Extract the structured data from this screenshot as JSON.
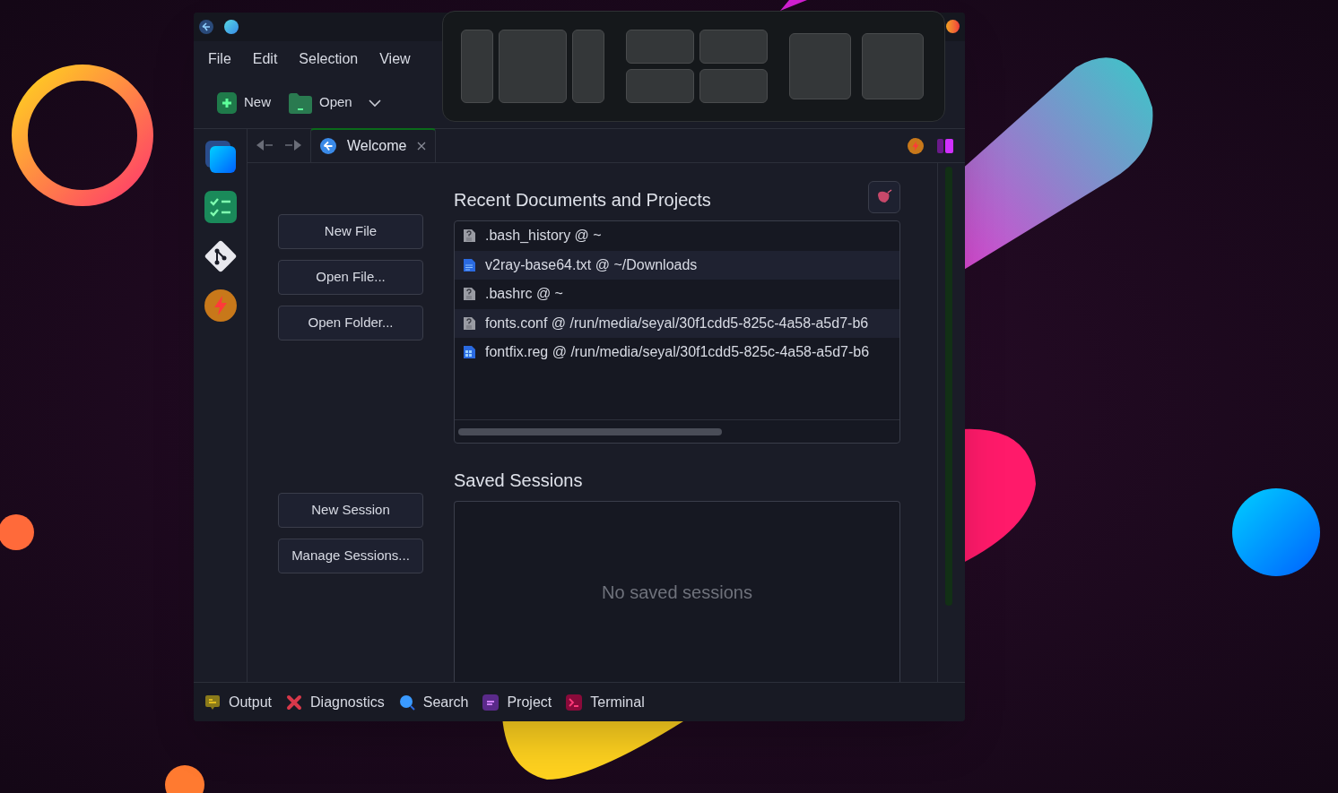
{
  "menu": [
    {
      "label": "File"
    },
    {
      "label": "Edit"
    },
    {
      "label": "Selection"
    },
    {
      "label": "View"
    }
  ],
  "toolbar": [
    {
      "label": "New",
      "kind": "new"
    },
    {
      "label": "Open",
      "kind": "open"
    }
  ],
  "tabs": [
    {
      "label": "Welcome",
      "selected": true
    }
  ],
  "start_buttons": [
    "New File",
    "Open File...",
    "Open Folder..."
  ],
  "recent": {
    "title": "Recent Documents and Projects",
    "items": [
      {
        "label": ".bash_history @ ~",
        "kind": "unknown"
      },
      {
        "label": "v2ray-base64.txt @ ~/Downloads",
        "kind": "text"
      },
      {
        "label": ".bashrc @ ~",
        "kind": "unknown"
      },
      {
        "label": "fonts.conf @ /run/media/seyal/30f1cdd5-825c-4a58-a5d7-b6",
        "kind": "unknown"
      },
      {
        "label": "fontfix.reg @ /run/media/seyal/30f1cdd5-825c-4a58-a5d7-b6",
        "kind": "registry"
      }
    ]
  },
  "sessions": {
    "title": "Saved Sessions",
    "buttons": [
      "New Session",
      "Manage Sessions..."
    ],
    "empty_text": "No saved sessions"
  },
  "bottom_bar": [
    {
      "label": "Output",
      "kind": "output"
    },
    {
      "label": "Diagnostics",
      "kind": "diagnostics"
    },
    {
      "label": "Search",
      "kind": "search"
    },
    {
      "label": "Project",
      "kind": "project"
    },
    {
      "label": "Terminal",
      "kind": "terminal"
    }
  ]
}
